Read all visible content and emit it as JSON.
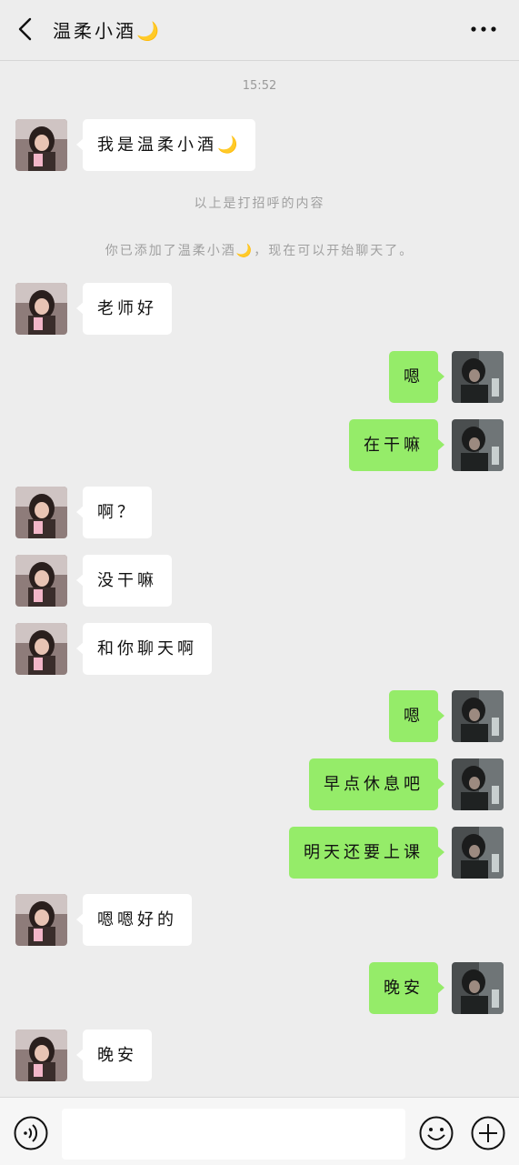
{
  "header": {
    "title": "温柔小酒🌙"
  },
  "timestamp": "15:52",
  "system_messages": [
    "以上是打招呼的内容",
    "你已添加了温柔小酒🌙，现在可以开始聊天了。"
  ],
  "messages": [
    {
      "side": "left",
      "text": "我是温柔小酒🌙"
    },
    {
      "side": "left",
      "text": "老师好"
    },
    {
      "side": "right",
      "text": "嗯"
    },
    {
      "side": "right",
      "text": "在干嘛"
    },
    {
      "side": "left",
      "text": "啊？"
    },
    {
      "side": "left",
      "text": "没干嘛"
    },
    {
      "side": "left",
      "text": "和你聊天啊"
    },
    {
      "side": "right",
      "text": "嗯"
    },
    {
      "side": "right",
      "text": "早点休息吧"
    },
    {
      "side": "right",
      "text": "明天还要上课"
    },
    {
      "side": "left",
      "text": "嗯嗯好的"
    },
    {
      "side": "right",
      "text": "晚安"
    },
    {
      "side": "left",
      "text": "晚安"
    }
  ],
  "input": {
    "value": "",
    "placeholder": ""
  },
  "colors": {
    "background": "#ededed",
    "sent_bubble": "#95ec69",
    "received_bubble": "#ffffff"
  },
  "icons": [
    "back-arrow-icon",
    "more-dots-icon",
    "voice-icon",
    "emoji-icon",
    "plus-icon"
  ]
}
